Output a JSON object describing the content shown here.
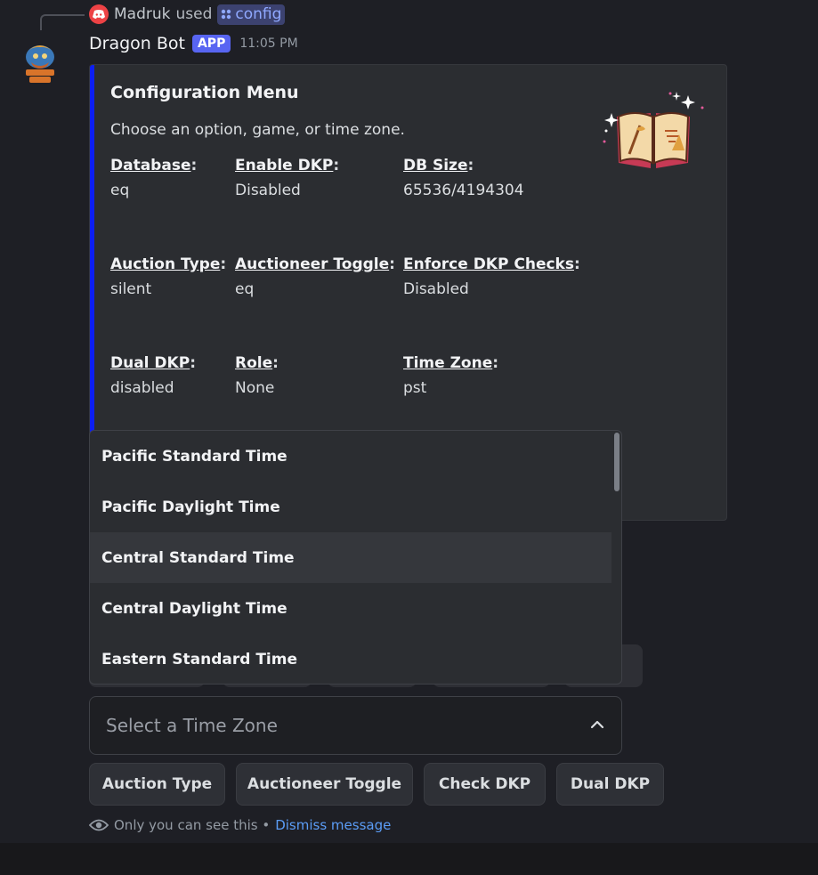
{
  "reply": {
    "user": "Madruk",
    "used": "used",
    "command": "config"
  },
  "header": {
    "bot_name": "Dragon Bot",
    "badge": "APP",
    "time": "11:05 PM"
  },
  "embed": {
    "accent_color": "#0c1ef2",
    "title": "Configuration Menu",
    "description": "Choose an option, game, or time zone.",
    "fields": [
      {
        "name": "Database",
        "value": "eq"
      },
      {
        "name": "Enable DKP",
        "value": "Disabled"
      },
      {
        "name": "DB Size",
        "value": "65536/4194304"
      },
      {
        "name": "Auction Type",
        "value": "silent"
      },
      {
        "name": "Auctioneer Toggle",
        "value": "eq"
      },
      {
        "name": "Enforce DKP Checks",
        "value": "Disabled"
      },
      {
        "name": "Dual DKP",
        "value": "disabled"
      },
      {
        "name": "Role",
        "value": "None"
      },
      {
        "name": "Time Zone",
        "value": "pst"
      }
    ]
  },
  "dropdown": {
    "options": [
      "Pacific Standard Time",
      "Pacific Daylight Time",
      "Central Standard Time",
      "Central Daylight Time",
      "Eastern Standard Time"
    ],
    "hovered": "Central Standard Time"
  },
  "select": {
    "placeholder": "Select a Time Zone"
  },
  "buttons": [
    "Auction Type",
    "Auctioneer Toggle",
    "Check DKP",
    "Dual DKP"
  ],
  "notice": {
    "text": "Only you can see this •",
    "dismiss": "Dismiss message"
  }
}
